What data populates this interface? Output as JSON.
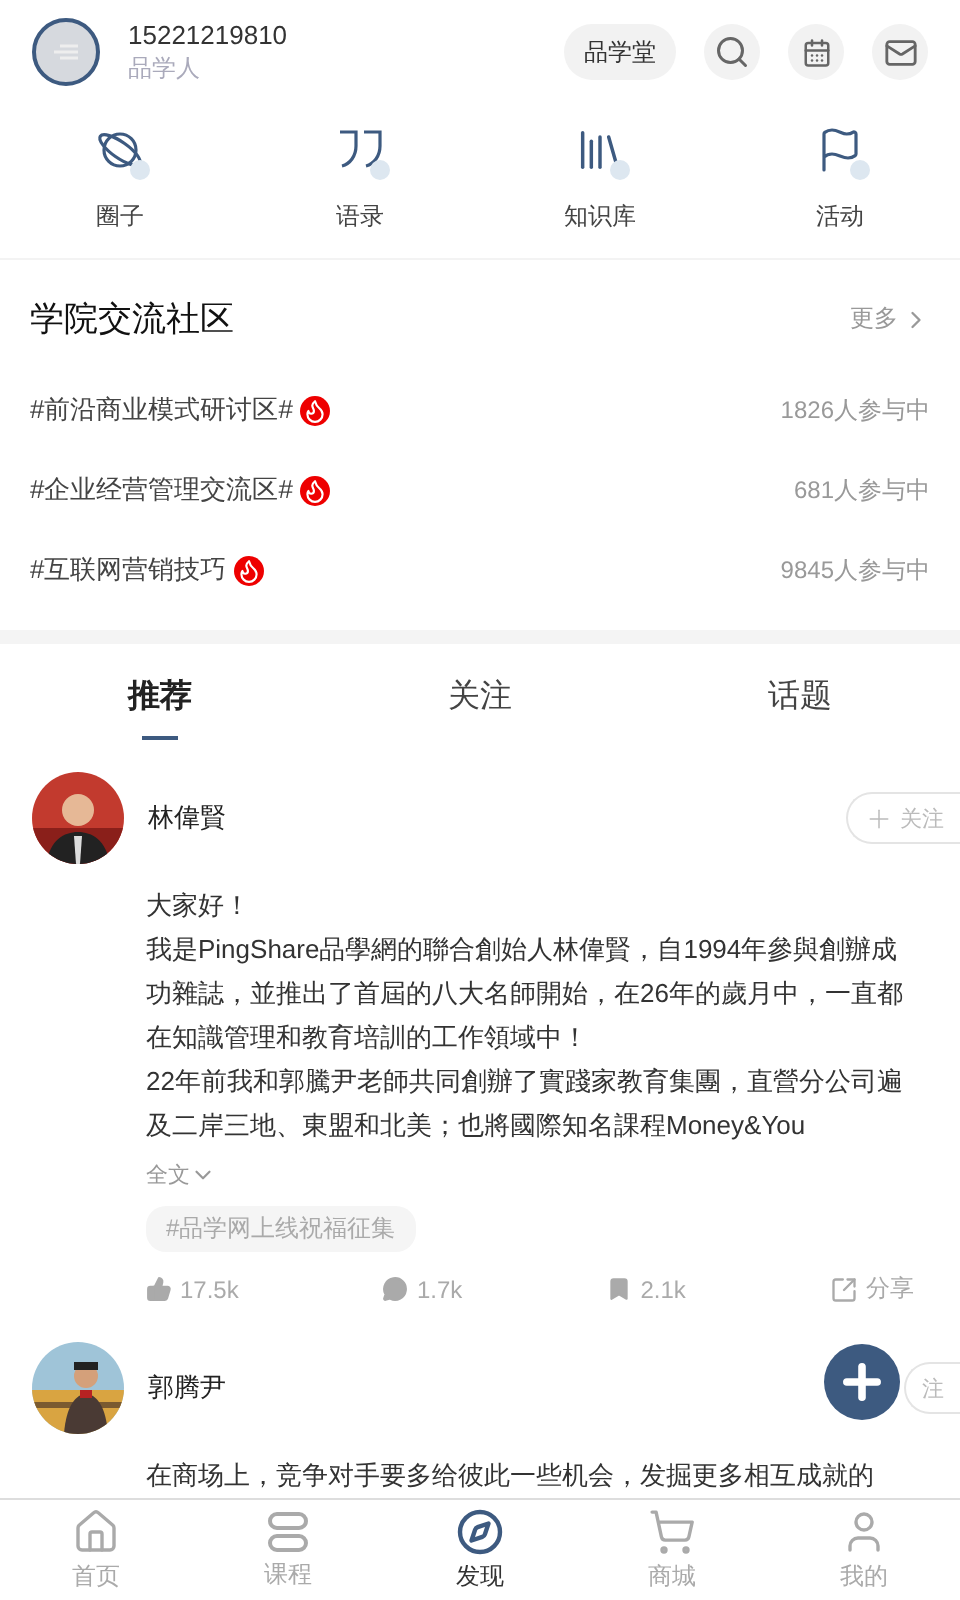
{
  "header": {
    "phone": "15221219810",
    "role": "品学人",
    "badge": "品学堂"
  },
  "quick_nav": [
    {
      "label": "圈子",
      "kind": "planet"
    },
    {
      "label": "语录",
      "kind": "quote"
    },
    {
      "label": "知识库",
      "kind": "books"
    },
    {
      "label": "活动",
      "kind": "flag"
    }
  ],
  "community": {
    "title": "学院交流社区",
    "more": "更多",
    "topics": [
      {
        "name": "#前沿商业模式研讨区#",
        "hot": true,
        "count": "1826人参与中"
      },
      {
        "name": "#企业经营管理交流区#",
        "hot": true,
        "count": "681人参与中"
      },
      {
        "name": "#互联网营销技巧",
        "hot": true,
        "count": "9845人参与中"
      }
    ]
  },
  "feed_tabs": [
    {
      "label": "推荐",
      "selected": true
    },
    {
      "label": "关注",
      "selected": false
    },
    {
      "label": "话题",
      "selected": false
    }
  ],
  "posts": [
    {
      "author": "林偉賢",
      "follow": {
        "label": "关注",
        "plus": true
      },
      "paragraphs": [
        "大家好！",
        "我是PingShare品學網的聯合創始人林偉賢，自1994年參與創辦成功雜誌，並推出了首屆的八大名師開始，在26年的歲月中，一直都在知識管理和教育培訓的工作領域中！",
        "22年前我和郭騰尹老師共同創辦了實踐家教育集團，直營分公司遍及二岸三地、東盟和北美；也將國際知名課程Money&You"
      ],
      "expand": "全文",
      "tag": "#品学网上线祝福征集",
      "likes": "17.5k",
      "comments": "1.7k",
      "saves": "2.1k",
      "share": "分享"
    },
    {
      "author": "郭腾尹",
      "follow": {
        "label": "注",
        "plus": false
      },
      "paragraphs": [
        "在商场上，竞争对手要多给彼此一些机会，发掘更多相互成就的"
      ]
    }
  ],
  "bottom_nav": [
    {
      "label": "首页",
      "kind": "home",
      "selected": false
    },
    {
      "label": "课程",
      "kind": "course",
      "selected": false
    },
    {
      "label": "发现",
      "kind": "discover",
      "selected": true
    },
    {
      "label": "商城",
      "kind": "cart",
      "selected": false
    },
    {
      "label": "我的",
      "kind": "user",
      "selected": false
    }
  ]
}
